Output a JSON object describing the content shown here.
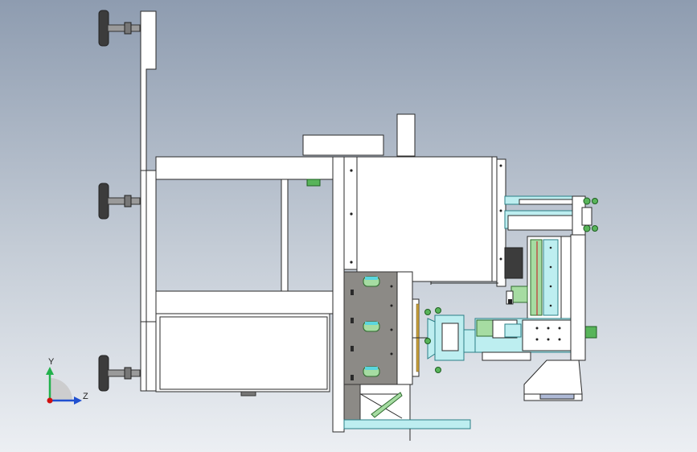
{
  "view": {
    "background_top": "#8e9cb0",
    "background_bottom": "#eceff3"
  },
  "triad": {
    "y_label": "Y",
    "z_label": "Z",
    "y_color": "#22b14c",
    "z_color": "#2050d0",
    "origin_color": "#d01010"
  }
}
